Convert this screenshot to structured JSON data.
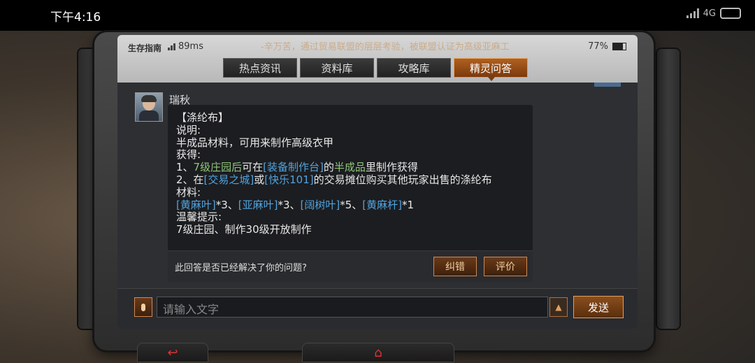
{
  "system": {
    "time": "下午4:16",
    "network": "4G"
  },
  "topbar": {
    "guide": "生存指南",
    "ping": "89ms",
    "ticker": "-辛万苦，通过贸易联盟的层层考验，被联盟认证为高级亚麻工",
    "battery": "77%",
    "battery_level": 0.77
  },
  "tabs": [
    {
      "label": "热点资讯"
    },
    {
      "label": "资料库"
    },
    {
      "label": "攻略库"
    },
    {
      "label": "精灵问答",
      "active": true
    }
  ],
  "chat": {
    "name": "瑞秋",
    "footer_question": "此回答是否已经解决了你的问题?",
    "btn_correct": "纠错",
    "btn_rate": "评价"
  },
  "input": {
    "placeholder": "请输入文字",
    "send": "发送",
    "up_icon": "chevron-up-icon"
  },
  "hardware": {
    "back_icon": "back-arrow-icon",
    "home_icon": "home-icon"
  },
  "colors": {
    "accent": "#e0a060",
    "green": "#8ec77a",
    "blue": "#4fa4e0"
  }
}
